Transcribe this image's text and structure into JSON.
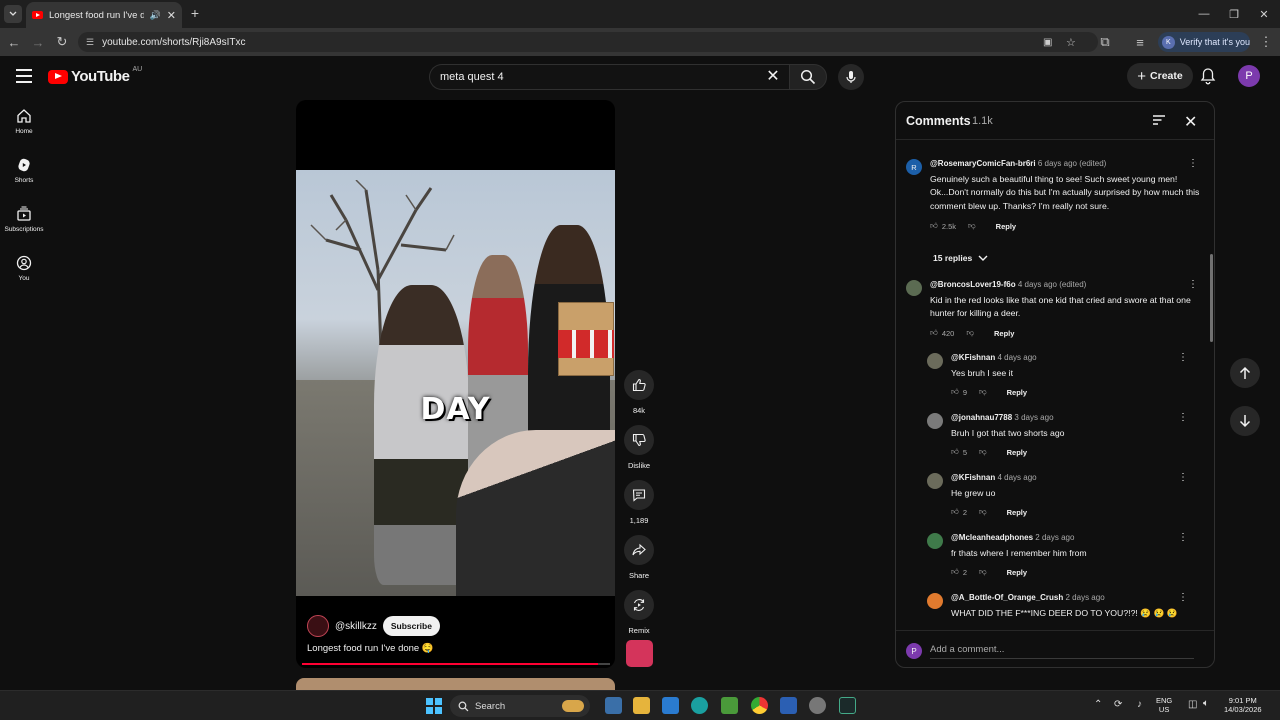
{
  "browser": {
    "tab_title": "Longest food run I've done 🤤",
    "url": "youtube.com/shorts/Rji8A9sITxc",
    "verify_label": "Verify that it's you",
    "verify_avatar": "K"
  },
  "header": {
    "logo_text": "YouTube",
    "logo_country": "AU",
    "search_value": "meta quest 4",
    "create_label": "Create",
    "avatar_letter": "P"
  },
  "guide": [
    {
      "label": "Home",
      "icon": "home-icon"
    },
    {
      "label": "Shorts",
      "icon": "shorts-icon"
    },
    {
      "label": "Subscriptions",
      "icon": "subscriptions-icon"
    },
    {
      "label": "You",
      "icon": "you-icon"
    }
  ],
  "short": {
    "overlay_text": "DAY",
    "channel": "@skillkzz",
    "subscribe_label": "Subscribe",
    "caption": "Longest food run I've done 🤤",
    "progress": 0.96
  },
  "actions": {
    "like_count": "84k",
    "dislike_label": "Dislike",
    "comment_count": "1,189",
    "share_label": "Share",
    "remix_label": "Remix"
  },
  "comments": {
    "title": "Comments",
    "count": "1.1k",
    "replies_toggle": "15 replies",
    "add_placeholder": "Add a comment...",
    "reply_label": "Reply",
    "items": [
      {
        "author": "@RosemaryComicFan-br6ri",
        "time": "6 days ago (edited)",
        "text": "Genuinely such a beautiful thing to see! Such sweet young men! Ok...Don't normally do this but I'm actually surprised by how much this comment blew up. Thanks? I'm really not sure.",
        "likes": "2.5k",
        "avatar_color": "#1c5fa8",
        "avatar_letter": "R"
      },
      {
        "author": "@BroncosLover19-f6o",
        "time": "4 days ago (edited)",
        "text": "Kid in the red looks like that one kid that cried and swore at that one hunter for killing a deer.",
        "likes": "420",
        "avatar_color": "#5b6b52",
        "avatar_letter": ""
      },
      {
        "author": "@KFishnan",
        "time": "4 days ago",
        "text": "Yes bruh I see it",
        "likes": "9",
        "avatar_color": "#6b6b5b",
        "avatar_letter": ""
      },
      {
        "author": "@jonahnau7788",
        "time": "3 days ago",
        "text": "Bruh I got that two shorts ago",
        "likes": "5",
        "avatar_color": "#7a7a7a",
        "avatar_letter": ""
      },
      {
        "author": "@KFishnan",
        "time": "4 days ago",
        "text": "He grew uo",
        "likes": "2",
        "avatar_color": "#6b6b5b",
        "avatar_letter": ""
      },
      {
        "author": "@Mcleanheadphones",
        "time": "2 days ago",
        "text": "fr thats where I remember him from",
        "likes": "2",
        "avatar_color": "#3f7a4a",
        "avatar_letter": ""
      },
      {
        "author": "@A_Bottle-Of_Orange_Crush",
        "time": "2 days ago",
        "text": "WHAT DID THE F***ING DEER DO TO YOU?!?! 😢 😢 😢",
        "likes": "",
        "avatar_color": "#e07a2e",
        "avatar_letter": ""
      }
    ]
  },
  "taskbar": {
    "search_label": "Search",
    "lang_top": "ENG",
    "lang_bottom": "US",
    "time": "9:01 PM",
    "date": "14/03/2026"
  }
}
